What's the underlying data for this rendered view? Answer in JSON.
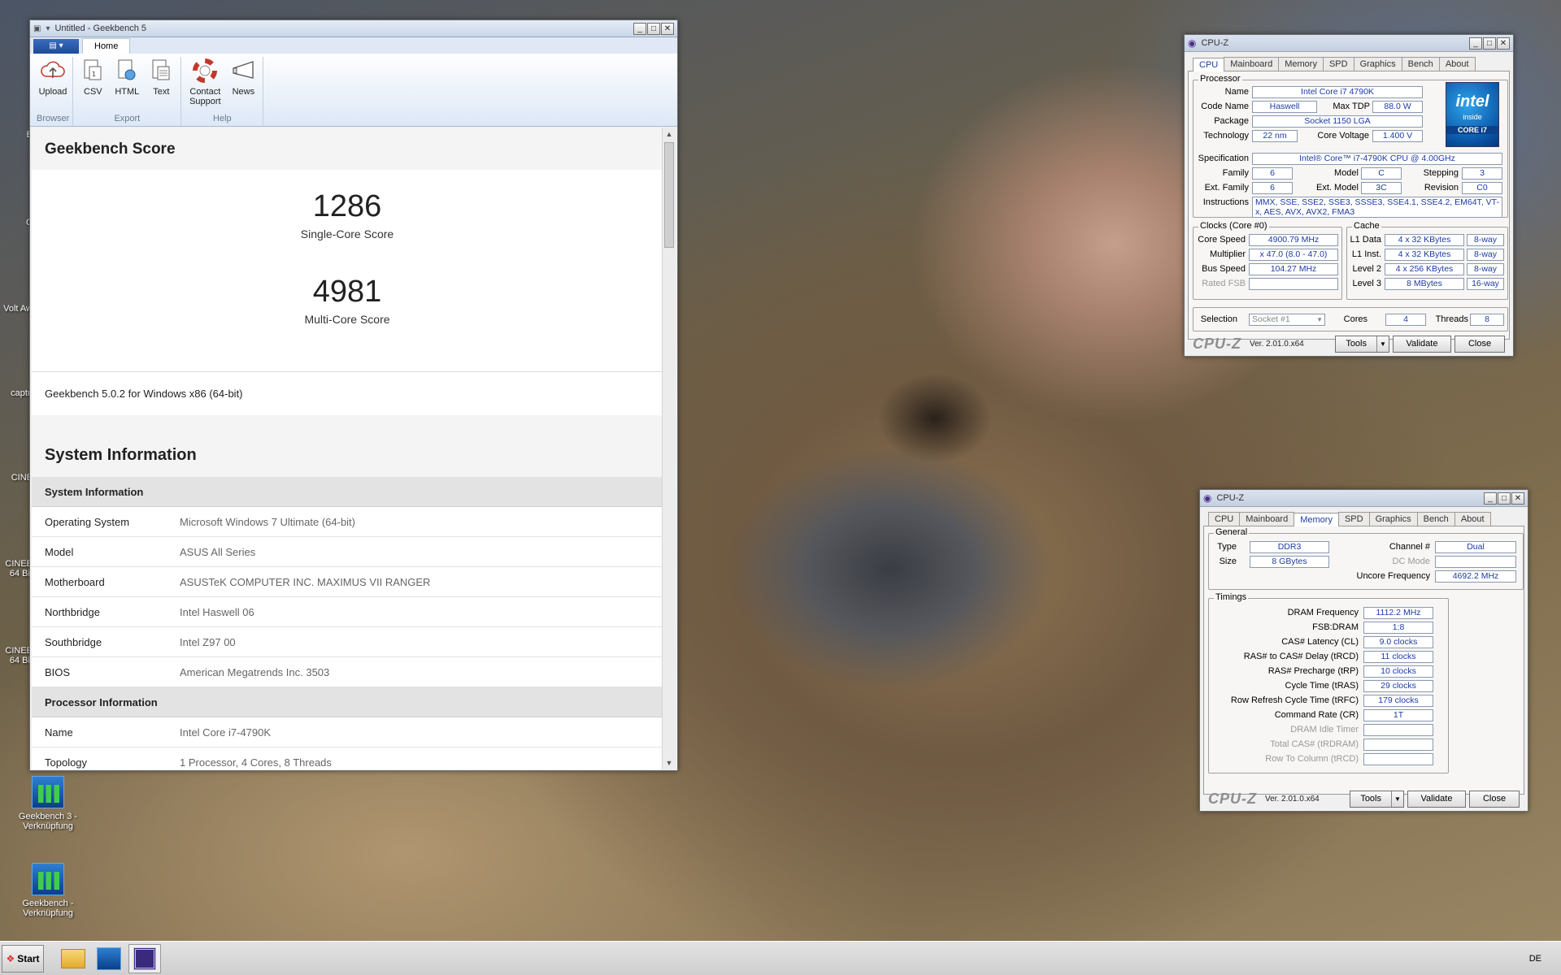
{
  "desktop": {
    "icons": [
      {
        "label": "Geekbench 3 - Verknüpfung"
      },
      {
        "label": "Geekbench - Verknüpfung"
      }
    ],
    "edge_labels": [
      "B",
      "C",
      "Volt Aw",
      "captu",
      "CINE",
      "CINEE 64 Bit",
      "CINEE 64 Bit"
    ]
  },
  "geekbench": {
    "title": "Untitled - Geekbench 5",
    "tab_home": "Home",
    "ribbon": {
      "groups": [
        {
          "label": "Browser",
          "buttons": [
            {
              "label": "Upload",
              "icon": "cloud-upload-icon"
            }
          ]
        },
        {
          "label": "Export",
          "buttons": [
            {
              "label": "CSV",
              "icon": "csv-document-icon"
            },
            {
              "label": "HTML",
              "icon": "html-document-icon"
            },
            {
              "label": "Text",
              "icon": "text-document-icon"
            }
          ]
        },
        {
          "label": "Help",
          "buttons": [
            {
              "label": "Contact Support",
              "icon": "lifebuoy-icon"
            },
            {
              "label": "News",
              "icon": "megaphone-icon"
            }
          ]
        }
      ]
    },
    "score_title": "Geekbench Score",
    "single_score": "1286",
    "single_label": "Single-Core Score",
    "multi_score": "4981",
    "multi_label": "Multi-Core Score",
    "version": "Geekbench 5.0.2 for Windows x86 (64-bit)",
    "sysinfo_title": "System Information",
    "sysinfo_sub": "System Information",
    "sysinfo_rows": [
      {
        "k": "Operating System",
        "v": "Microsoft Windows 7 Ultimate (64-bit)"
      },
      {
        "k": "Model",
        "v": "ASUS All Series"
      },
      {
        "k": "Motherboard",
        "v": "ASUSTeK COMPUTER INC. MAXIMUS VII RANGER"
      },
      {
        "k": "Northbridge",
        "v": "Intel Haswell 06"
      },
      {
        "k": "Southbridge",
        "v": "Intel Z97 00"
      },
      {
        "k": "BIOS",
        "v": "American Megatrends Inc. 3503"
      }
    ],
    "proc_sub": "Processor Information",
    "proc_rows": [
      {
        "k": "Name",
        "v": "Intel Core i7-4790K"
      },
      {
        "k": "Topology",
        "v": "1 Processor, 4 Cores, 8 Threads"
      }
    ]
  },
  "cpuz1": {
    "title": "CPU-Z",
    "tabs": [
      "CPU",
      "Mainboard",
      "Memory",
      "SPD",
      "Graphics",
      "Bench",
      "About"
    ],
    "active_tab": "CPU",
    "processor": {
      "group": "Processor",
      "name_l": "Name",
      "name": "Intel Core i7 4790K",
      "code_l": "Code Name",
      "code": "Haswell",
      "tdp_l": "Max TDP",
      "tdp": "88.0 W",
      "pkg_l": "Package",
      "pkg": "Socket 1150 LGA",
      "tech_l": "Technology",
      "tech": "22 nm",
      "volt_l": "Core Voltage",
      "volt": "1.400 V",
      "spec_l": "Specification",
      "spec": "Intel® Core™ i7-4790K CPU @ 4.00GHz",
      "fam_l": "Family",
      "fam": "6",
      "model_l": "Model",
      "model": "C",
      "step_l": "Stepping",
      "step": "3",
      "efam_l": "Ext. Family",
      "efam": "6",
      "emodel_l": "Ext. Model",
      "emodel": "3C",
      "rev_l": "Revision",
      "rev": "C0",
      "instr_l": "Instructions",
      "instr": "MMX, SSE, SSE2, SSE3, SSSE3, SSE4.1, SSE4.2, EM64T, VT-x, AES, AVX, AVX2, FMA3"
    },
    "intel": {
      "l1": "intel",
      "l2": "inside",
      "l3": "CORE i7"
    },
    "clocks": {
      "group": "Clocks (Core #0)",
      "cs_l": "Core Speed",
      "cs": "4900.79 MHz",
      "mul_l": "Multiplier",
      "mul": "x 47.0 (8.0 - 47.0)",
      "bus_l": "Bus Speed",
      "bus": "104.27 MHz",
      "fsb_l": "Rated FSB",
      "fsb": ""
    },
    "cache": {
      "group": "Cache",
      "l1d_l": "L1 Data",
      "l1d": "4 x 32 KBytes",
      "l1d_w": "8-way",
      "l1i_l": "L1 Inst.",
      "l1i": "4 x 32 KBytes",
      "l1i_w": "8-way",
      "l2_l": "Level 2",
      "l2": "4 x 256 KBytes",
      "l2_w": "8-way",
      "l3_l": "Level 3",
      "l3": "8 MBytes",
      "l3_w": "16-way"
    },
    "sel_l": "Selection",
    "sel": "Socket #1",
    "cores_l": "Cores",
    "cores": "4",
    "threads_l": "Threads",
    "threads": "8",
    "logo": "CPU-Z",
    "ver": "Ver. 2.01.0.x64",
    "tools": "Tools",
    "validate": "Validate",
    "close": "Close"
  },
  "cpuz2": {
    "title": "CPU-Z",
    "tabs": [
      "CPU",
      "Mainboard",
      "Memory",
      "SPD",
      "Graphics",
      "Bench",
      "About"
    ],
    "active_tab": "Memory",
    "general": {
      "group": "General",
      "type_l": "Type",
      "type": "DDR3",
      "size_l": "Size",
      "size": "8 GBytes",
      "ch_l": "Channel #",
      "ch": "Dual",
      "dc_l": "DC Mode",
      "dc": "",
      "unc_l": "Uncore Frequency",
      "unc": "4692.2 MHz"
    },
    "timings": {
      "group": "Timings",
      "rows": [
        {
          "l": "DRAM Frequency",
          "v": "1112.2 MHz",
          "dim": false
        },
        {
          "l": "FSB:DRAM",
          "v": "1:8",
          "dim": false
        },
        {
          "l": "CAS# Latency (CL)",
          "v": "9.0 clocks",
          "dim": false
        },
        {
          "l": "RAS# to CAS# Delay (tRCD)",
          "v": "11 clocks",
          "dim": false
        },
        {
          "l": "RAS# Precharge (tRP)",
          "v": "10 clocks",
          "dim": false
        },
        {
          "l": "Cycle Time (tRAS)",
          "v": "29 clocks",
          "dim": false
        },
        {
          "l": "Row Refresh Cycle Time (tRFC)",
          "v": "179 clocks",
          "dim": false
        },
        {
          "l": "Command Rate (CR)",
          "v": "1T",
          "dim": false
        },
        {
          "l": "DRAM Idle Timer",
          "v": "",
          "dim": true
        },
        {
          "l": "Total CAS# (tRDRAM)",
          "v": "",
          "dim": true
        },
        {
          "l": "Row To Column (tRCD)",
          "v": "",
          "dim": true
        }
      ]
    },
    "logo": "CPU-Z",
    "ver": "Ver. 2.01.0.x64",
    "tools": "Tools",
    "validate": "Validate",
    "close": "Close"
  },
  "taskbar": {
    "start": "Start",
    "lang": "DE"
  }
}
